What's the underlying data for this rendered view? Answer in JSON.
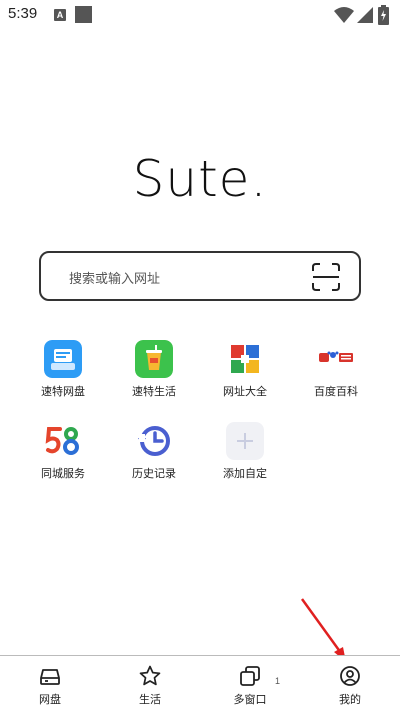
{
  "status_bar": {
    "time": "5:39",
    "notification_icon_letter": "A",
    "icons": [
      "a-notification-icon",
      "square-notification-icon",
      "wifi-icon",
      "signal-icon",
      "battery-charging-icon"
    ]
  },
  "logo": {
    "text": "Sute",
    "dot": "."
  },
  "search": {
    "placeholder": "搜索或输入网址",
    "scan_icon": "scan-icon"
  },
  "shortcuts": [
    {
      "label": "速特网盘",
      "icon": "cloud-disk-icon",
      "color": "#2d9cf5"
    },
    {
      "label": "速特生活",
      "icon": "life-cup-icon",
      "color": "#3cc24c"
    },
    {
      "label": "网址大全",
      "icon": "url-grid-icon",
      "color": "#e03a2f"
    },
    {
      "label": "百度百科",
      "icon": "baidu-baike-icon",
      "color": "#d8342c"
    },
    {
      "label": "同城服务",
      "icon": "58-city-icon",
      "color": "#e5452c"
    },
    {
      "label": "历史记录",
      "icon": "history-clock-icon",
      "color": "#4a5fd0"
    },
    {
      "label": "添加自定",
      "icon": "add-plus-icon",
      "color": "#c9cde0"
    }
  ],
  "bottom_nav": {
    "items": [
      {
        "label": "网盘",
        "icon": "disk-icon"
      },
      {
        "label": "生活",
        "icon": "star-icon"
      },
      {
        "label": "多窗口",
        "icon": "windows-icon"
      },
      {
        "label": "我的",
        "icon": "profile-icon"
      }
    ],
    "window_count": "1"
  },
  "annotation": {
    "color": "#e02020"
  }
}
